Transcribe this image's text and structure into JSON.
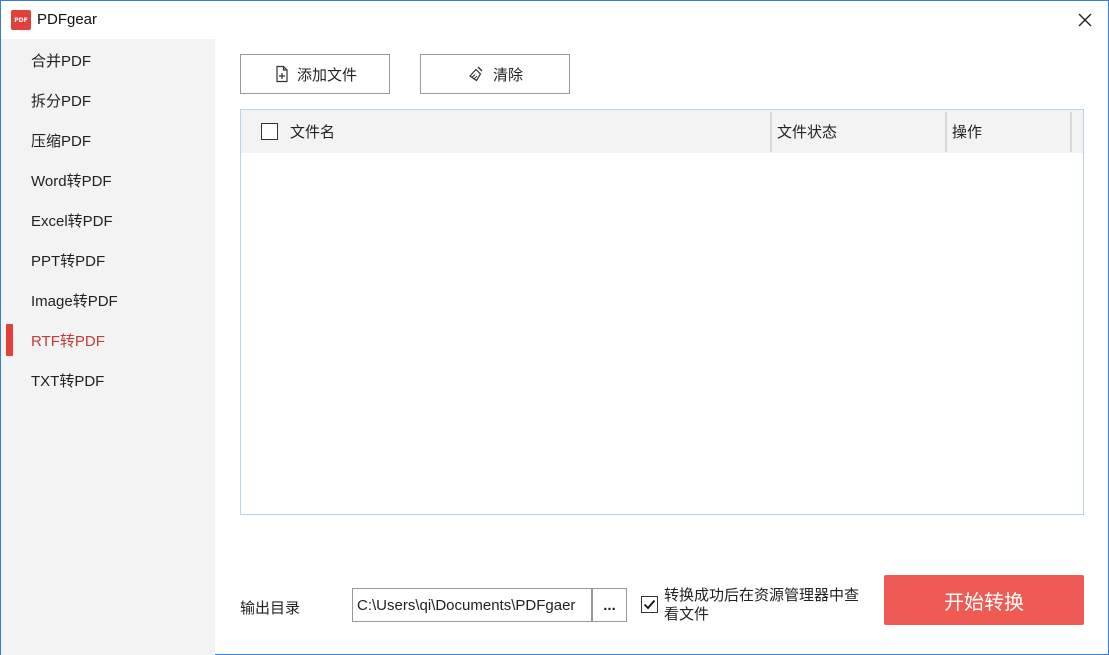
{
  "app": {
    "logo_text": "PDF",
    "title": "PDFgear"
  },
  "sidebar": {
    "items": [
      {
        "label": "合并PDF"
      },
      {
        "label": "拆分PDF"
      },
      {
        "label": "压缩PDF"
      },
      {
        "label": "Word转PDF"
      },
      {
        "label": "Excel转PDF"
      },
      {
        "label": "PPT转PDF"
      },
      {
        "label": "Image转PDF"
      },
      {
        "label": "RTF转PDF"
      },
      {
        "label": "TXT转PDF"
      }
    ],
    "active_index": 7
  },
  "toolbar": {
    "add_label": "添加文件",
    "clear_label": "清除"
  },
  "table": {
    "columns": [
      "文件名",
      "文件状态",
      "操作"
    ],
    "rows": []
  },
  "output": {
    "label": "输出目录",
    "path": "C:\\Users\\qi\\Documents\\PDFgaer",
    "browse_label": "...",
    "open_after_label": "转换成功后在资源管理器中查看文件",
    "open_after_checked": true
  },
  "start_button": {
    "label": "开始转换"
  },
  "colors": {
    "accent": "#e2403a",
    "start_button": "#ef5b52",
    "active_text": "#c53a3a"
  },
  "icons": [
    "pdf-logo-icon",
    "close-icon",
    "add-file-icon",
    "broom-icon",
    "checkmark-icon"
  ]
}
